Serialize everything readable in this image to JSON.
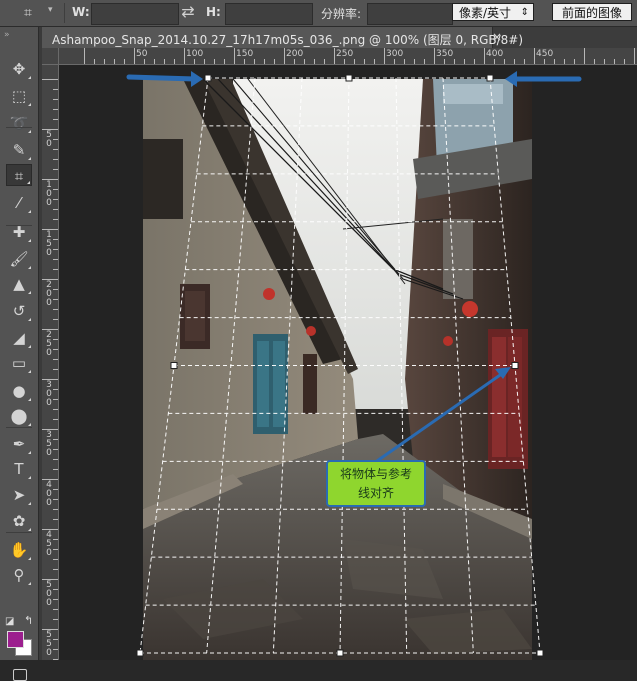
{
  "options_bar": {
    "tool_icon": "perspective-crop-icon",
    "width_label": "W:",
    "width_value": "",
    "height_label": "H:",
    "height_value": "",
    "swap_icon": "swap-arrows-icon",
    "resolution_label": "分辨率:",
    "resolution_value": "",
    "unit_select": "像素/英寸",
    "front_image_button": "前面的图像"
  },
  "document": {
    "tab_title": "Ashampoo_Snap_2014.10.27_17h17m05s_036_.png @ 100% (图层 0, RGB/8#)",
    "close_glyph": "×"
  },
  "ruler_top": [
    "50",
    "100",
    "150",
    "200",
    "250",
    "300",
    "350",
    "400",
    "450"
  ],
  "ruler_left": [
    "5 0",
    "1 0 0",
    "1 5 0",
    "2 0 0",
    "2 5 0",
    "3 0 0",
    "3 5 0",
    "4 0 0",
    "4 5 0",
    "5 0 0",
    "5 5 0"
  ],
  "tools": [
    {
      "name": "move-tool",
      "icon": "move-icon",
      "glyph": "✥"
    },
    {
      "name": "marquee-tool",
      "icon": "rect-marquee-icon",
      "glyph": "⬚"
    },
    {
      "name": "lasso-tool",
      "icon": "lasso-icon",
      "glyph": "➰"
    },
    {
      "name": "quick-select-tool",
      "icon": "quick-select-icon",
      "glyph": "✎"
    },
    {
      "name": "crop-tool",
      "icon": "perspective-crop-icon",
      "glyph": "⌗"
    },
    {
      "name": "eyedropper-tool",
      "icon": "eyedropper-icon",
      "glyph": "⁄"
    },
    {
      "name": "healing-tool",
      "icon": "bandage-icon",
      "glyph": "✚"
    },
    {
      "name": "brush-tool",
      "icon": "brush-icon",
      "glyph": "🖌"
    },
    {
      "name": "stamp-tool",
      "icon": "stamp-icon",
      "glyph": "▲"
    },
    {
      "name": "history-brush-tool",
      "icon": "history-brush-icon",
      "glyph": "↺"
    },
    {
      "name": "eraser-tool",
      "icon": "eraser-icon",
      "glyph": "◢"
    },
    {
      "name": "gradient-tool",
      "icon": "gradient-icon",
      "glyph": "▭"
    },
    {
      "name": "blur-tool",
      "icon": "blur-drop-icon",
      "glyph": "●"
    },
    {
      "name": "dodge-tool",
      "icon": "dodge-icon",
      "glyph": "⬤"
    },
    {
      "name": "pen-tool",
      "icon": "pen-icon",
      "glyph": "✒"
    },
    {
      "name": "type-tool",
      "icon": "type-icon",
      "glyph": "T"
    },
    {
      "name": "path-select-tool",
      "icon": "path-select-icon",
      "glyph": "➤"
    },
    {
      "name": "shape-tool",
      "icon": "custom-shape-icon",
      "glyph": "✿"
    },
    {
      "name": "hand-tool",
      "icon": "hand-icon",
      "glyph": "✋"
    },
    {
      "name": "zoom-tool",
      "icon": "zoom-icon",
      "glyph": "⚲"
    }
  ],
  "colors": {
    "foreground": "#9c1f8e",
    "background": "#ffffff",
    "callout_fill": "#8fd62e",
    "arrow_blue": "#2a6bb3"
  },
  "annotation": {
    "callout_line1": "将物体与参考",
    "callout_line2": "线对齐"
  }
}
